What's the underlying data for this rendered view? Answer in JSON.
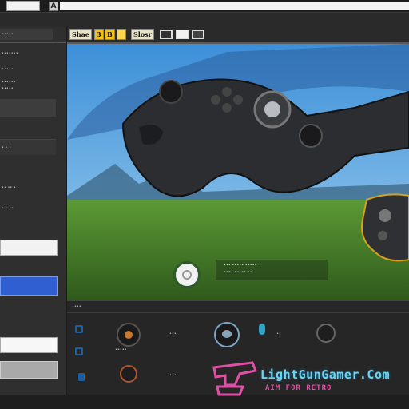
{
  "toolbar": {
    "tool_1": "Shae",
    "tool_2": "3",
    "tool_3": "B",
    "tool_4": "Slosr"
  },
  "top": {
    "search_value": "",
    "button_label": "A"
  },
  "sidebar": {
    "label_a": "•••••",
    "label_b": "•••••••",
    "label_c": "•••••",
    "label_d": "••••••",
    "label_e": "• • •",
    "label_f": "•• •• •",
    "label_g": "• • ••",
    "field_value": "",
    "field_value_2": ""
  },
  "viewport": {
    "caption_line_1": "••• ••••• •••••",
    "caption_line_2": "•••• ••••• ••"
  },
  "lower": {
    "header": "••••",
    "slot_1": "•••••",
    "slot_2": "•••",
    "slot_3": "••",
    "slot_4": "•••"
  },
  "watermark": {
    "title": "LightGunGamer.Com",
    "tagline": "AIM FOR RETRO"
  },
  "colors": {
    "accent_blue": "#2f5fd0",
    "sky": "#3a7fc6",
    "grass": "#4c8a2c",
    "controller": "#2b2d30",
    "highlight": "#6fd3f2",
    "magenta": "#e04fa5"
  }
}
